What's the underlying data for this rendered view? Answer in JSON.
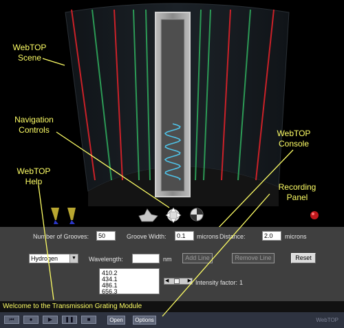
{
  "callouts": {
    "scene": "WebTOP\nScene",
    "navigation": "Navigation\nControls",
    "console": "WebTOP\nConsole",
    "help": "WebTOP\nHelp",
    "recording": "Recording\nPanel"
  },
  "console": {
    "grooves_label": "Number of Grooves:",
    "grooves_value": "50",
    "groove_width_label": "Groove Width:",
    "groove_width_value": "0.1",
    "groove_width_unit": "microns",
    "distance_label": "Distance:",
    "distance_value": "2.0",
    "distance_unit": "microns",
    "element_select": "Hydrogen",
    "wavelength_label": "Wavelength:",
    "wavelength_value": "",
    "wavelength_unit": "nm",
    "add_line": "Add Line",
    "remove_line": "Remove Line",
    "reset": "Reset",
    "wavelength_list": [
      "410.2",
      "434.1",
      "486.1",
      "656.3"
    ],
    "intensity_label": "Intensity factor:",
    "intensity_value": "1"
  },
  "status_message": "Welcome to the Transmission Grating Module",
  "recorder": {
    "open": "Open",
    "options": "Options",
    "brand": "WebTOP"
  },
  "colors": {
    "callout": "#ffff66",
    "red_line": "#e0222a",
    "green_line": "#2fa85c",
    "wave": "#4fc3e8"
  },
  "icons": [
    "rewind-icon",
    "record-icon",
    "play-icon",
    "pause-icon",
    "stop-icon",
    "pan-icon",
    "translate-icon",
    "examine-icon",
    "spotlight-icon",
    "record-indicator-icon"
  ]
}
